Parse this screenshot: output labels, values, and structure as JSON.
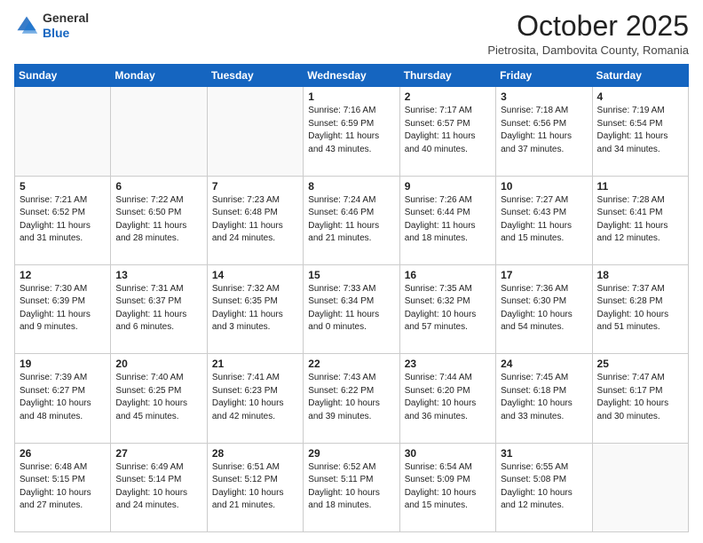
{
  "header": {
    "logo_general": "General",
    "logo_blue": "Blue",
    "month": "October 2025",
    "location": "Pietrosita, Dambovita County, Romania"
  },
  "days_of_week": [
    "Sunday",
    "Monday",
    "Tuesday",
    "Wednesday",
    "Thursday",
    "Friday",
    "Saturday"
  ],
  "weeks": [
    [
      {
        "day": "",
        "info": ""
      },
      {
        "day": "",
        "info": ""
      },
      {
        "day": "",
        "info": ""
      },
      {
        "day": "1",
        "info": "Sunrise: 7:16 AM\nSunset: 6:59 PM\nDaylight: 11 hours\nand 43 minutes."
      },
      {
        "day": "2",
        "info": "Sunrise: 7:17 AM\nSunset: 6:57 PM\nDaylight: 11 hours\nand 40 minutes."
      },
      {
        "day": "3",
        "info": "Sunrise: 7:18 AM\nSunset: 6:56 PM\nDaylight: 11 hours\nand 37 minutes."
      },
      {
        "day": "4",
        "info": "Sunrise: 7:19 AM\nSunset: 6:54 PM\nDaylight: 11 hours\nand 34 minutes."
      }
    ],
    [
      {
        "day": "5",
        "info": "Sunrise: 7:21 AM\nSunset: 6:52 PM\nDaylight: 11 hours\nand 31 minutes."
      },
      {
        "day": "6",
        "info": "Sunrise: 7:22 AM\nSunset: 6:50 PM\nDaylight: 11 hours\nand 28 minutes."
      },
      {
        "day": "7",
        "info": "Sunrise: 7:23 AM\nSunset: 6:48 PM\nDaylight: 11 hours\nand 24 minutes."
      },
      {
        "day": "8",
        "info": "Sunrise: 7:24 AM\nSunset: 6:46 PM\nDaylight: 11 hours\nand 21 minutes."
      },
      {
        "day": "9",
        "info": "Sunrise: 7:26 AM\nSunset: 6:44 PM\nDaylight: 11 hours\nand 18 minutes."
      },
      {
        "day": "10",
        "info": "Sunrise: 7:27 AM\nSunset: 6:43 PM\nDaylight: 11 hours\nand 15 minutes."
      },
      {
        "day": "11",
        "info": "Sunrise: 7:28 AM\nSunset: 6:41 PM\nDaylight: 11 hours\nand 12 minutes."
      }
    ],
    [
      {
        "day": "12",
        "info": "Sunrise: 7:30 AM\nSunset: 6:39 PM\nDaylight: 11 hours\nand 9 minutes."
      },
      {
        "day": "13",
        "info": "Sunrise: 7:31 AM\nSunset: 6:37 PM\nDaylight: 11 hours\nand 6 minutes."
      },
      {
        "day": "14",
        "info": "Sunrise: 7:32 AM\nSunset: 6:35 PM\nDaylight: 11 hours\nand 3 minutes."
      },
      {
        "day": "15",
        "info": "Sunrise: 7:33 AM\nSunset: 6:34 PM\nDaylight: 11 hours\nand 0 minutes."
      },
      {
        "day": "16",
        "info": "Sunrise: 7:35 AM\nSunset: 6:32 PM\nDaylight: 10 hours\nand 57 minutes."
      },
      {
        "day": "17",
        "info": "Sunrise: 7:36 AM\nSunset: 6:30 PM\nDaylight: 10 hours\nand 54 minutes."
      },
      {
        "day": "18",
        "info": "Sunrise: 7:37 AM\nSunset: 6:28 PM\nDaylight: 10 hours\nand 51 minutes."
      }
    ],
    [
      {
        "day": "19",
        "info": "Sunrise: 7:39 AM\nSunset: 6:27 PM\nDaylight: 10 hours\nand 48 minutes."
      },
      {
        "day": "20",
        "info": "Sunrise: 7:40 AM\nSunset: 6:25 PM\nDaylight: 10 hours\nand 45 minutes."
      },
      {
        "day": "21",
        "info": "Sunrise: 7:41 AM\nSunset: 6:23 PM\nDaylight: 10 hours\nand 42 minutes."
      },
      {
        "day": "22",
        "info": "Sunrise: 7:43 AM\nSunset: 6:22 PM\nDaylight: 10 hours\nand 39 minutes."
      },
      {
        "day": "23",
        "info": "Sunrise: 7:44 AM\nSunset: 6:20 PM\nDaylight: 10 hours\nand 36 minutes."
      },
      {
        "day": "24",
        "info": "Sunrise: 7:45 AM\nSunset: 6:18 PM\nDaylight: 10 hours\nand 33 minutes."
      },
      {
        "day": "25",
        "info": "Sunrise: 7:47 AM\nSunset: 6:17 PM\nDaylight: 10 hours\nand 30 minutes."
      }
    ],
    [
      {
        "day": "26",
        "info": "Sunrise: 6:48 AM\nSunset: 5:15 PM\nDaylight: 10 hours\nand 27 minutes."
      },
      {
        "day": "27",
        "info": "Sunrise: 6:49 AM\nSunset: 5:14 PM\nDaylight: 10 hours\nand 24 minutes."
      },
      {
        "day": "28",
        "info": "Sunrise: 6:51 AM\nSunset: 5:12 PM\nDaylight: 10 hours\nand 21 minutes."
      },
      {
        "day": "29",
        "info": "Sunrise: 6:52 AM\nSunset: 5:11 PM\nDaylight: 10 hours\nand 18 minutes."
      },
      {
        "day": "30",
        "info": "Sunrise: 6:54 AM\nSunset: 5:09 PM\nDaylight: 10 hours\nand 15 minutes."
      },
      {
        "day": "31",
        "info": "Sunrise: 6:55 AM\nSunset: 5:08 PM\nDaylight: 10 hours\nand 12 minutes."
      },
      {
        "day": "",
        "info": ""
      }
    ]
  ]
}
